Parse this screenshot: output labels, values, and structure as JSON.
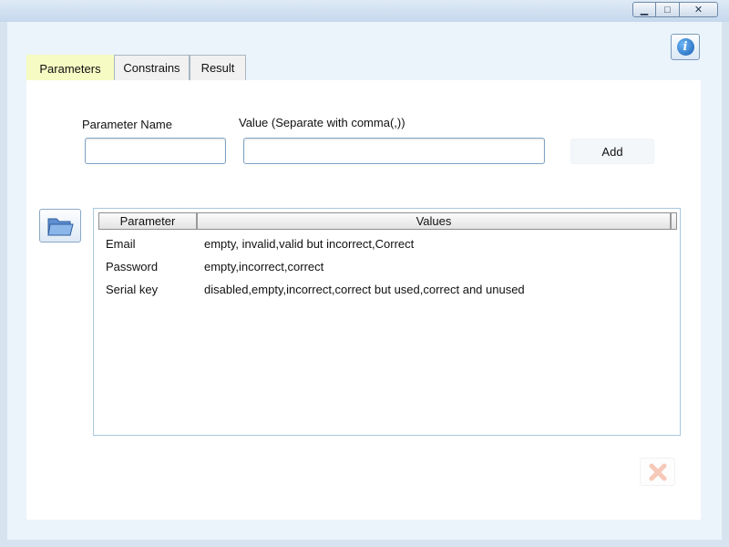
{
  "window": {
    "minimize_glyph": "▁",
    "maximize_glyph": "□",
    "close_glyph": "✕"
  },
  "tabs": [
    {
      "label": "Parameters",
      "active": true
    },
    {
      "label": "Constrains",
      "active": false
    },
    {
      "label": "Result",
      "active": false
    }
  ],
  "form": {
    "parameter_name_label": "Parameter Name",
    "value_label": "Value (Separate with comma(,))",
    "parameter_name_value": "",
    "value_value": "",
    "add_label": "Add"
  },
  "grid": {
    "columns": [
      "Parameter",
      "Values"
    ],
    "rows": [
      {
        "parameter": "Email",
        "values": "empty, invalid,valid but incorrect,Correct"
      },
      {
        "parameter": "Password",
        "values": "empty,incorrect,correct"
      },
      {
        "parameter": "Serial key",
        "values": "disabled,empty,incorrect,correct but used,correct and unused"
      }
    ]
  },
  "icons": {
    "info": "info-icon",
    "folder": "folder-open-icon",
    "remove": "close-x-icon",
    "info_glyph": "i"
  },
  "colors": {
    "active_tab": "#f5fbc2",
    "panel_background": "#ebf4fb",
    "remove_icon": "#f6c8b8"
  }
}
